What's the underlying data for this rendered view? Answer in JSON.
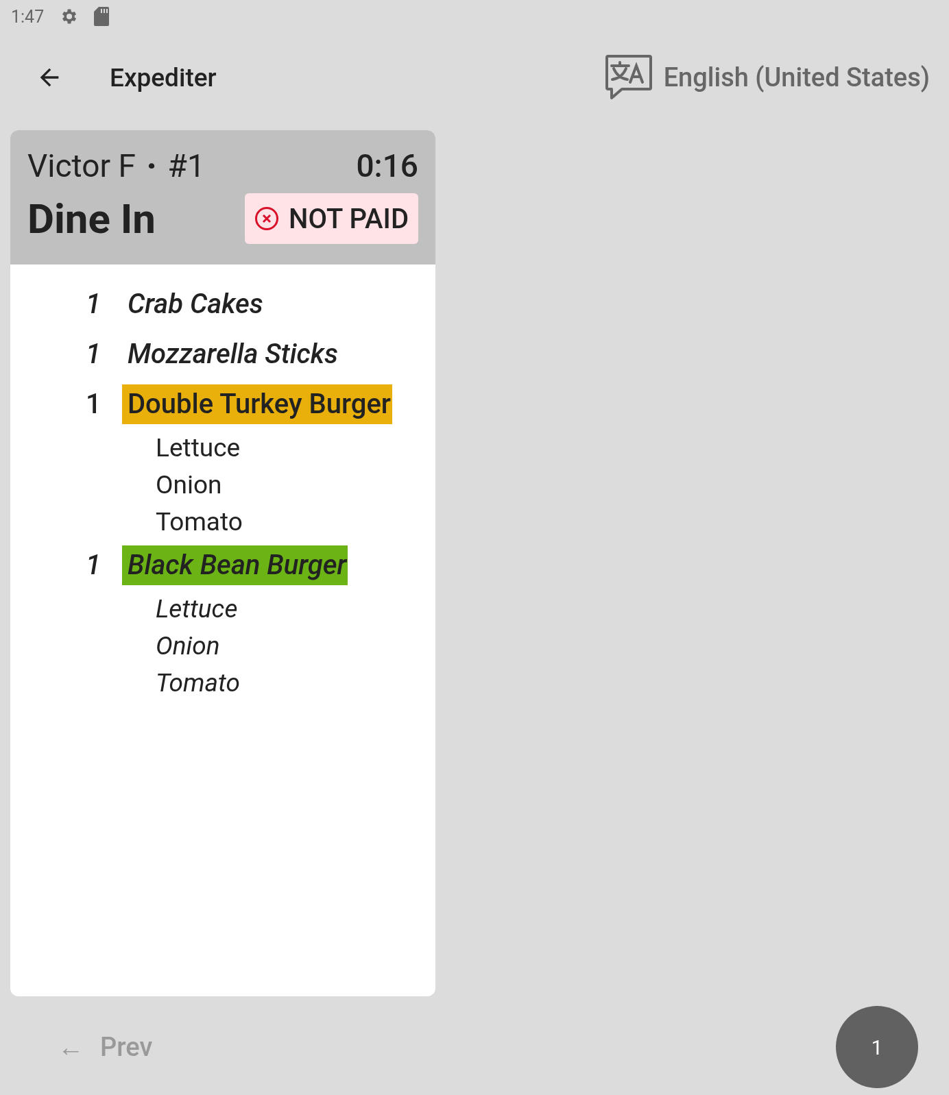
{
  "status_bar": {
    "time": "1:47"
  },
  "toolbar": {
    "title": "Expediter",
    "language": "English (United States)"
  },
  "order": {
    "customer": "Victor F",
    "separator": "·",
    "number": "#1",
    "timer": "0:16",
    "type": "Dine In",
    "payment": "NOT PAID",
    "items": [
      {
        "qty": "1",
        "name": "Crab Cakes",
        "italic": true
      },
      {
        "qty": "1",
        "name": "Mozzarella Sticks",
        "italic": true
      },
      {
        "qty": "1",
        "name": "Double Turkey Burger",
        "italic": false,
        "color": "#e9b00b",
        "modifiers": [
          "Lettuce",
          "Onion",
          "Tomato"
        ]
      },
      {
        "qty": "1",
        "name": "Black Bean Burger",
        "italic": true,
        "color": "#6cb416",
        "modifiers": [
          "Lettuce",
          "Onion",
          "Tomato"
        ]
      }
    ]
  },
  "footer": {
    "prev": "Prev",
    "arrow": "←",
    "page": "1"
  }
}
